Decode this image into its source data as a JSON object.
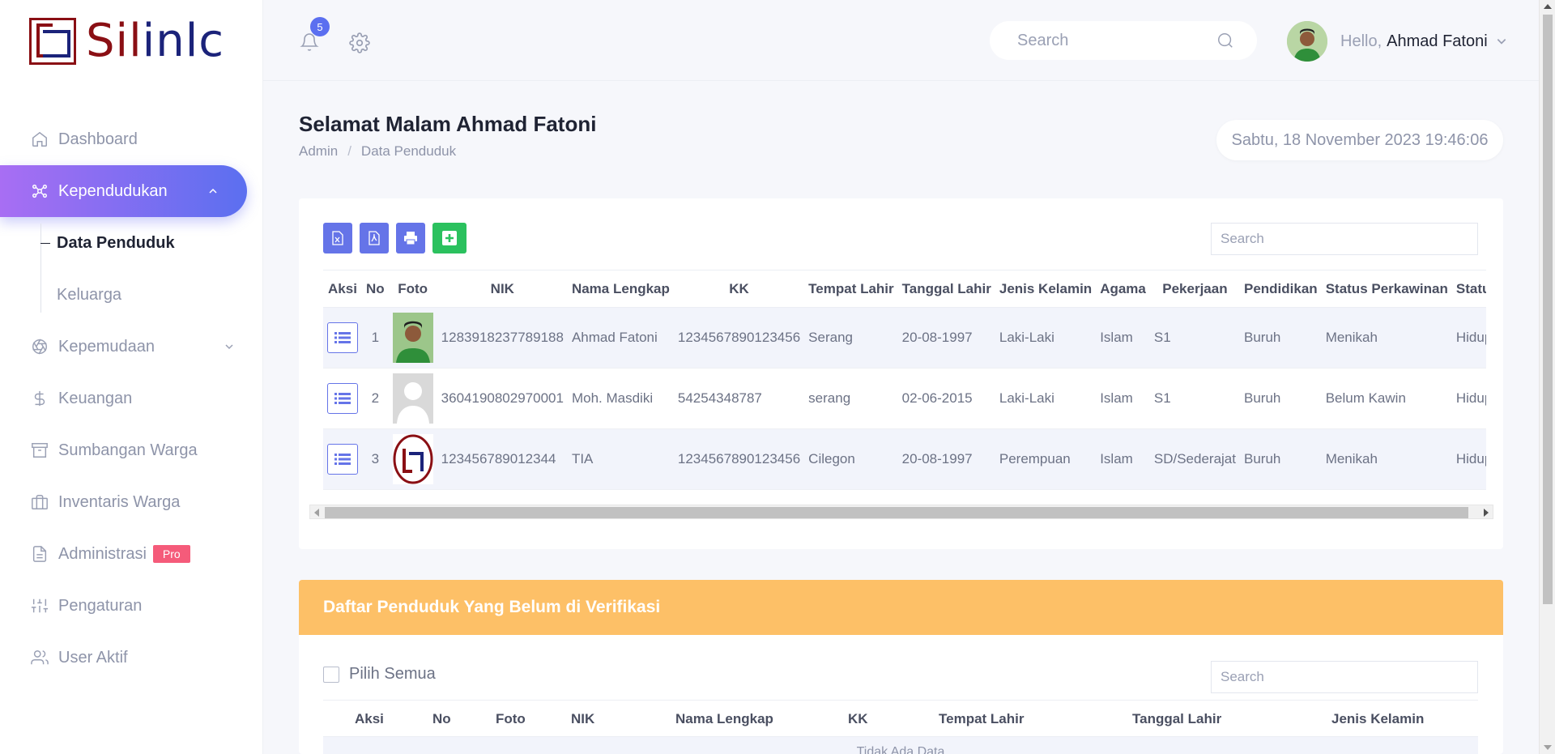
{
  "brand": {
    "logo_text_a": "Sil",
    "logo_text_b": "inlc",
    "colors": {
      "primary": "#8a0f14",
      "secondary": "#1b237a"
    }
  },
  "sidebar": {
    "items": [
      {
        "label": "Dashboard",
        "icon": "home-icon"
      },
      {
        "label": "Kependudukan",
        "icon": "network-icon",
        "active": true,
        "expanded": true
      },
      {
        "label": "Kepemudaan",
        "icon": "aperture-icon"
      },
      {
        "label": "Keuangan",
        "icon": "dollar-icon"
      },
      {
        "label": "Sumbangan Warga",
        "icon": "archive-icon"
      },
      {
        "label": "Inventaris Warga",
        "icon": "briefcase-icon"
      },
      {
        "label": "Administrasi",
        "icon": "file-icon",
        "badge": "Pro"
      },
      {
        "label": "Pengaturan",
        "icon": "sliders-icon"
      },
      {
        "label": "User Aktif",
        "icon": "users-icon"
      }
    ],
    "sub_items": [
      "Data Penduduk",
      "Keluarga"
    ]
  },
  "topbar": {
    "notifications": "5",
    "search_placeholder": "Search",
    "hello": "Hello,",
    "user_name": "Ahmad Fatoni"
  },
  "page": {
    "title": "Selamat Malam Ahmad Fatoni",
    "breadcrumb": [
      "Admin",
      "Data Penduduk"
    ],
    "datetime": "Sabtu, 18 November 2023 19:46:06"
  },
  "penduduk_table": {
    "search_placeholder": "Search",
    "columns": [
      "Aksi",
      "No",
      "Foto",
      "NIK",
      "Nama Lengkap",
      "KK",
      "Tempat Lahir",
      "Tanggal Lahir",
      "Jenis Kelamin",
      "Agama",
      "Pekerjaan",
      "Pendidikan",
      "Status Perkawinan",
      "Status"
    ],
    "rows": [
      {
        "no": "1",
        "foto": "photo",
        "nik": "1283918237789188",
        "nama": "Ahmad Fatoni",
        "kk": "1234567890123456",
        "tempat": "Serang",
        "tanggal": "20-08-1997",
        "jk": "Laki-Laki",
        "agama": "Islam",
        "pekerjaan": "S1",
        "pendidikan": "Buruh",
        "perkawinan": "Menikah",
        "status": "Hidup"
      },
      {
        "no": "2",
        "foto": "placeholder",
        "nik": "3604190802970001",
        "nama": "Moh. Masdiki",
        "kk": "54254348787",
        "tempat": "serang",
        "tanggal": "02-06-2015",
        "jk": "Laki-Laki",
        "agama": "Islam",
        "pekerjaan": "S1",
        "pendidikan": "Buruh",
        "perkawinan": "Belum Kawin",
        "status": "Hidup"
      },
      {
        "no": "3",
        "foto": "logo",
        "nik": "123456789012344",
        "nama": "TIA",
        "kk": "1234567890123456",
        "tempat": "Cilegon",
        "tanggal": "20-08-1997",
        "jk": "Perempuan",
        "agama": "Islam",
        "pekerjaan": "SD/Sederajat",
        "pendidikan": "Buruh",
        "perkawinan": "Menikah",
        "status": "Hidup"
      }
    ]
  },
  "verifikasi": {
    "title": "Daftar Penduduk Yang Belum di Verifikasi",
    "select_all": "Pilih Semua",
    "search_placeholder": "Search",
    "columns": [
      "Aksi",
      "No",
      "Foto",
      "NIK",
      "Nama Lengkap",
      "KK",
      "Tempat Lahir",
      "Tanggal Lahir",
      "Jenis Kelamin"
    ],
    "empty": "Tidak Ada Data",
    "accent": "#fdc067"
  }
}
